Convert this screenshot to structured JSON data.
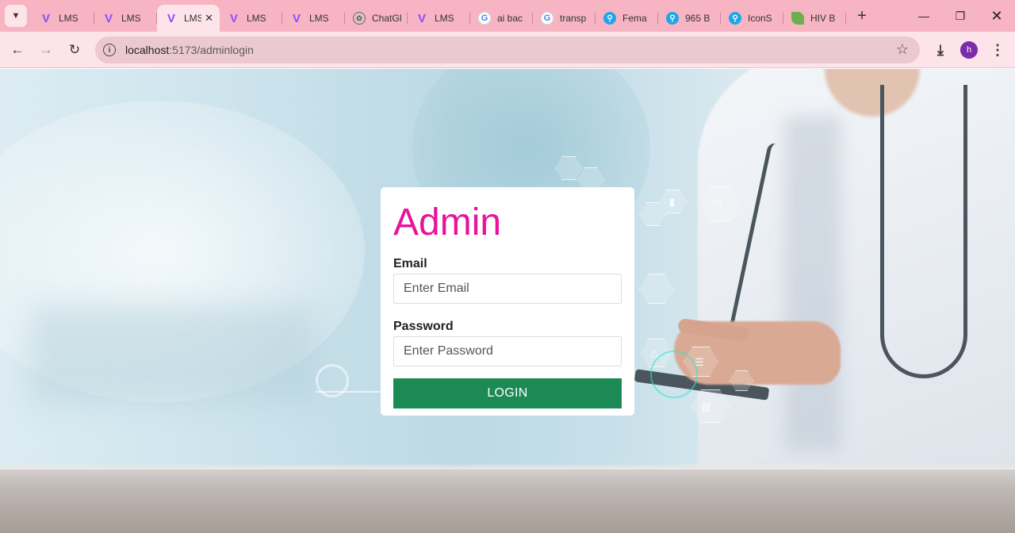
{
  "browser": {
    "tabs": [
      {
        "title": "LMS",
        "favicon": "vite-icon",
        "active": false
      },
      {
        "title": "LMS",
        "favicon": "vite-icon",
        "active": false
      },
      {
        "title": "LMS",
        "favicon": "vite-icon",
        "active": true
      },
      {
        "title": "LMS",
        "favicon": "vite-icon",
        "active": false
      },
      {
        "title": "LMS",
        "favicon": "vite-icon",
        "active": false
      },
      {
        "title": "ChatGPT",
        "favicon": "chatgpt-icon",
        "active": false
      },
      {
        "title": "LMS",
        "favicon": "vite-icon",
        "active": false
      },
      {
        "title": "ai bac",
        "favicon": "google-icon",
        "active": false
      },
      {
        "title": "transp",
        "favicon": "google-icon",
        "active": false
      },
      {
        "title": "Fema",
        "favicon": "search-icon",
        "active": false
      },
      {
        "title": "965 B",
        "favicon": "search-icon",
        "active": false
      },
      {
        "title": "IconS",
        "favicon": "search-icon",
        "active": false
      },
      {
        "title": "HIV B",
        "favicon": "leaf-icon",
        "active": false
      }
    ],
    "url_host": "localhost",
    "url_path": ":5173/adminlogin",
    "profile_initial": "h",
    "tab_close_glyph": "✕",
    "new_tab_glyph": "+"
  },
  "login": {
    "title": "Admin",
    "email_label": "Email",
    "email_placeholder": "Enter Email",
    "password_label": "Password",
    "password_placeholder": "Enter Password",
    "button_label": "LOGIN"
  },
  "colors": {
    "title_pink": "#e8139a",
    "button_green": "#1b8a55",
    "tab_strip": "#f7b4c2",
    "toolbar": "#fde3ea"
  }
}
